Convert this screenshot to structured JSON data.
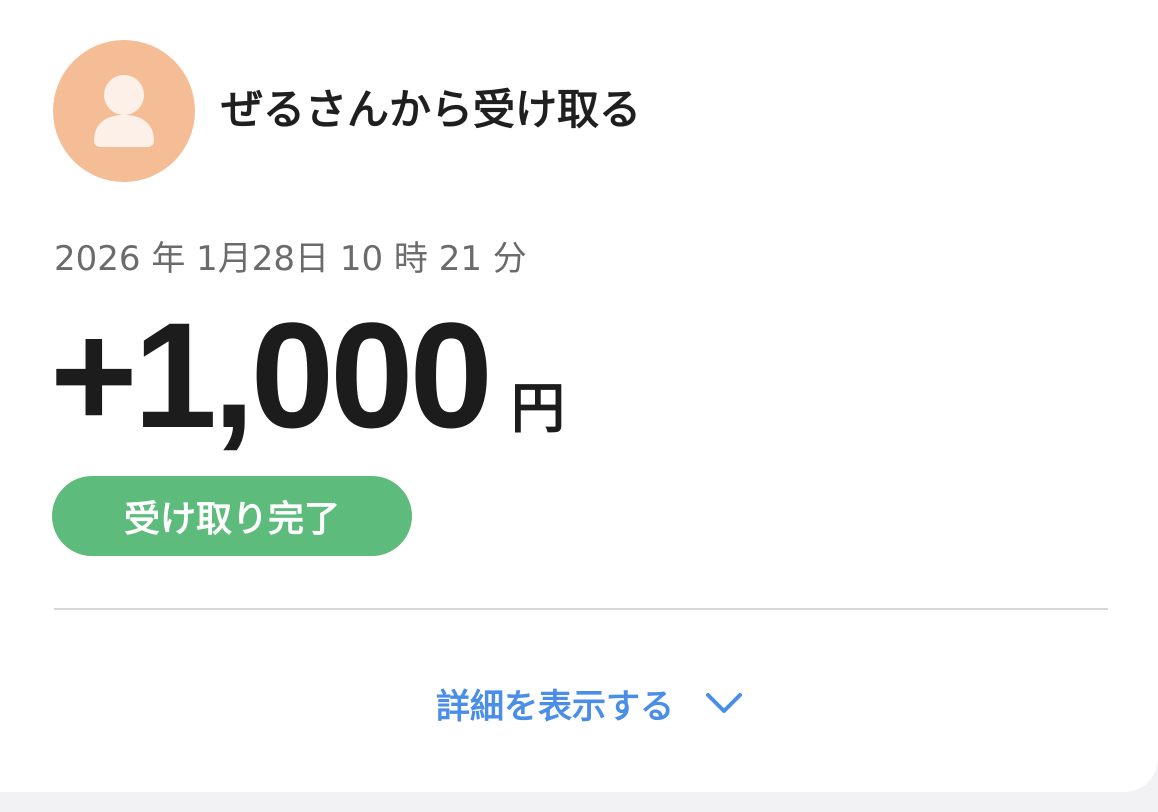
{
  "transaction": {
    "title": "ぜるさんから受け取る",
    "datetime": "2026 年 1月28日 10 時 21 分",
    "amount": "+1,000",
    "currency": "円",
    "status": "受け取り完了"
  },
  "details": {
    "toggle_label": "詳細を表示する",
    "icon": "chevron-down-icon"
  },
  "avatar": {
    "icon": "user-icon",
    "color": "#f5bd95"
  },
  "colors": {
    "status_badge": "#5dbb7b",
    "link": "#4b8ee8",
    "text": "#1c1c1c",
    "muted": "#6b6b6b"
  }
}
